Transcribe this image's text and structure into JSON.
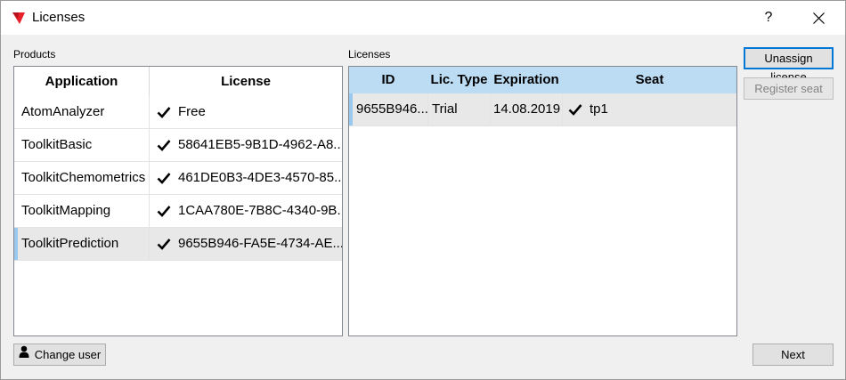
{
  "window": {
    "title": "Licenses",
    "help": "?"
  },
  "products": {
    "label": "Products",
    "columns": [
      "Application",
      "License"
    ],
    "rows": [
      {
        "application": "AtomAnalyzer",
        "license": "Free",
        "checked": true
      },
      {
        "application": "ToolkitBasic",
        "license": "58641EB5-9B1D-4962-A8...",
        "checked": true
      },
      {
        "application": "ToolkitChemometrics",
        "license": "461DE0B3-4DE3-4570-85...",
        "checked": true
      },
      {
        "application": "ToolkitMapping",
        "license": "1CAA780E-7B8C-4340-9B...",
        "checked": true
      },
      {
        "application": "ToolkitPrediction",
        "license": "9655B946-FA5E-4734-AE...",
        "checked": true,
        "selected": true
      }
    ]
  },
  "licenses": {
    "label": "Licenses",
    "columns": [
      "ID",
      "Lic. Type",
      "Expiration",
      "Seat"
    ],
    "rows": [
      {
        "id": "9655B946...",
        "type": "Trial",
        "expiration": "14.08.2019",
        "seat": "tp1",
        "checked": true
      }
    ]
  },
  "buttons": {
    "unassign": "Unassign license",
    "register": "Register seat",
    "change_user": "Change user",
    "next": "Next"
  },
  "colors": {
    "accent": "#0078d7",
    "header_blue": "#bcdcf4",
    "selection_marker": "#99c9ef",
    "app_icon_red": "#e8202a"
  }
}
